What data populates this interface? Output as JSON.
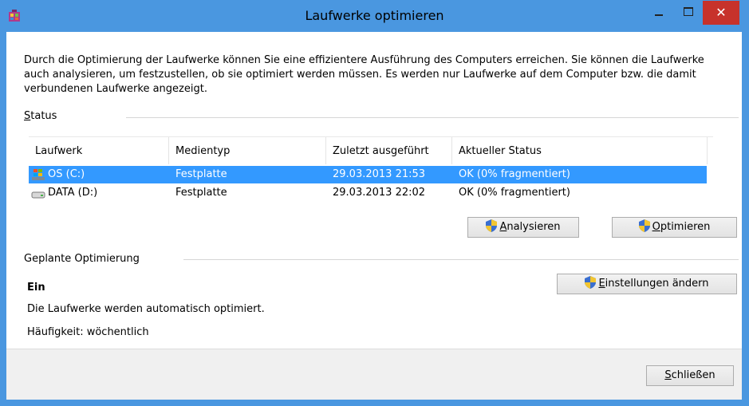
{
  "window": {
    "title": "Laufwerke optimieren",
    "close_label": "✕"
  },
  "description": "Durch die Optimierung der Laufwerke können Sie eine effizientere Ausführung des Computers erreichen. Sie können die Laufwerke auch analysieren, um festzustellen, ob sie optimiert werden müssen. Es werden nur Laufwerke auf dem Computer bzw. die damit verbundenen Laufwerke angezeigt.",
  "status_group": {
    "label_accel": "S",
    "label_rest": "tatus"
  },
  "table": {
    "headers": [
      "Laufwerk",
      "Medientyp",
      "Zuletzt ausgeführt",
      "Aktueller Status"
    ],
    "rows": [
      {
        "drive": "OS (C:)",
        "media": "Festplatte",
        "last_run": "29.03.2013 21:53",
        "status": "OK (0% fragmentiert)",
        "icon": "windows-drive-icon"
      },
      {
        "drive": "DATA (D:)",
        "media": "Festplatte",
        "last_run": "29.03.2013 22:02",
        "status": "OK (0% fragmentiert)",
        "icon": "hard-drive-icon"
      }
    ]
  },
  "buttons": {
    "analyze_accel": "A",
    "analyze_rest": "nalysieren",
    "optimize_accel": "O",
    "optimize_rest": "ptimieren",
    "settings_accel": "E",
    "settings_rest": "instellungen ändern",
    "close_accel": "S",
    "close_rest": "chließen"
  },
  "scheduled": {
    "label": "Geplante Optimierung",
    "state": "Ein",
    "auto_text": "Die Laufwerke werden automatisch optimiert.",
    "frequency": "Häufigkeit: wöchentlich"
  },
  "colors": {
    "titlebar": "#4a97e0",
    "selection": "#3399ff",
    "close": "#c7322b"
  }
}
